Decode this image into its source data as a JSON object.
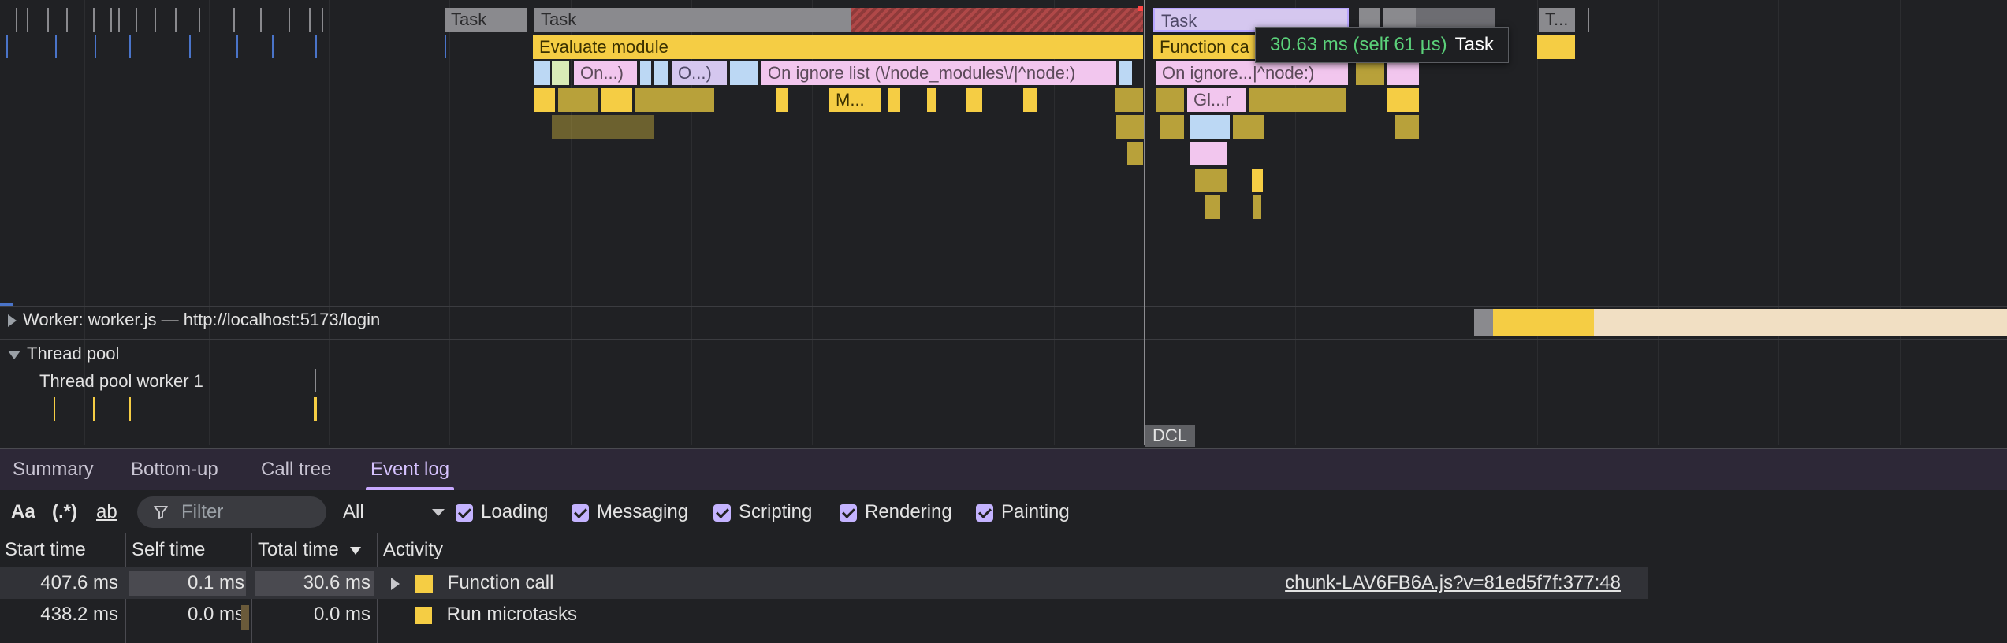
{
  "flame_chart": {
    "task_labels": [
      "Task",
      "Task",
      "Task",
      "T..."
    ],
    "evaluate_module": "Evaluate module",
    "function_call": "Function ca",
    "ignore_list_1": "On ignore list (\\/node_modules\\/|^node:)",
    "ignore_list_2": "On ignore...|^node:)",
    "on_short_1": "On...)",
    "on_short_2": "O...)",
    "m_short": "M...",
    "gl_short": "Gl...r",
    "tooltip_time": "30.63 ms (self 61 µs)",
    "tooltip_name": "Task",
    "dcl_marker": "DCL"
  },
  "tracks": {
    "worker": "Worker: worker.js — http://localhost:5173/login",
    "thread_pool": "Thread pool",
    "thread_pool_worker": "Thread pool worker 1"
  },
  "tabs": [
    "Summary",
    "Bottom-up",
    "Call tree",
    "Event log"
  ],
  "active_tab": "Event log",
  "toolbar": {
    "match_case": "Aa",
    "regex": "(.*)",
    "whole_word": "ab",
    "filter_placeholder": "Filter",
    "category_select": "All",
    "categories": [
      "Loading",
      "Messaging",
      "Scripting",
      "Rendering",
      "Painting"
    ]
  },
  "table": {
    "columns": [
      "Start time",
      "Self time",
      "Total time",
      "Activity"
    ],
    "rows": [
      {
        "start": "407.6 ms",
        "self": "0.1 ms",
        "total": "30.6 ms",
        "activity": "Function call",
        "link": "chunk-LAV6FB6A.js?v=81ed5f7f:377:48",
        "expandable": true
      },
      {
        "start": "438.2 ms",
        "self": "0.0 ms",
        "total": "0.0 ms",
        "activity": "Run microtasks",
        "link": "",
        "expandable": false
      }
    ]
  },
  "colors": {
    "scripting": "#f5cd44",
    "task": "#8a8a8e",
    "accent": "#c8a8ff"
  }
}
